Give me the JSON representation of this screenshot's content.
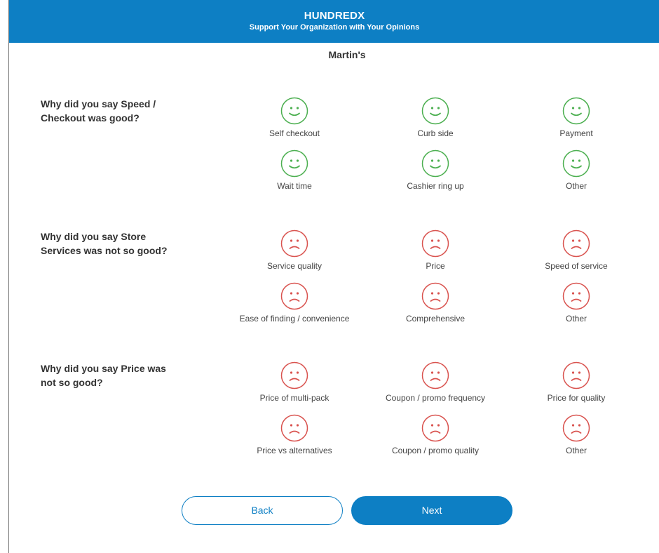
{
  "header": {
    "brand": "HUNDREDX",
    "tagline": "Support Your Organization with Your Opinions",
    "background_color": "#0d7fc4"
  },
  "store_name": "Martin's",
  "colors": {
    "positive": "#4caf50",
    "negative": "#d9534f",
    "accent": "#0d7fc4"
  },
  "sections": [
    {
      "question": "Why did you say Speed / Checkout was good?",
      "sentiment": "good",
      "face_icon": "smiley-face-icon",
      "options": [
        "Self checkout",
        "Curb side",
        "Payment",
        "Wait time",
        "Cashier ring up",
        "Other"
      ]
    },
    {
      "question": "Why did you say Store Services was not so good?",
      "sentiment": "not-good",
      "face_icon": "frown-face-icon",
      "options": [
        "Service quality",
        "Price",
        "Speed of service",
        "Ease of finding / convenience",
        "Comprehensive",
        "Other"
      ]
    },
    {
      "question": "Why did you say Price was not so good?",
      "sentiment": "not-good",
      "face_icon": "frown-face-icon",
      "options": [
        "Price of multi-pack",
        "Coupon / promo frequency",
        "Price for quality",
        "Price vs alternatives",
        "Coupon / promo quality",
        "Other"
      ]
    }
  ],
  "buttons": {
    "back": "Back",
    "next": "Next"
  }
}
